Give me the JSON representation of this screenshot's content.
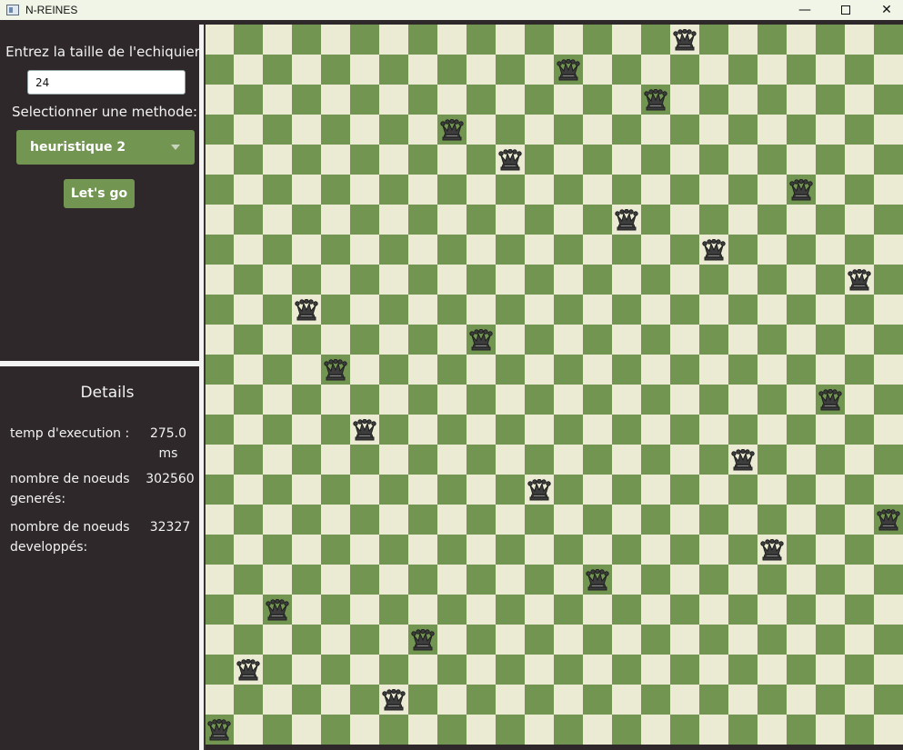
{
  "window": {
    "title": "N-REINES",
    "minimize_glyph": "—",
    "close_glyph": "✕"
  },
  "form": {
    "size_label": "Entrez la taille de l'echiquier",
    "size_value": "24",
    "method_label": "Selectionner une methode:",
    "method_selected": "heuristique 2",
    "go_label": "Let's go"
  },
  "details": {
    "title": "Details",
    "exec_label": "temp d'execution :",
    "exec_value": "275.0 ms",
    "generated_label": "nombre de noeuds generés:",
    "generated_value": "302560",
    "developed_label": "nombre de noeuds developpés:",
    "developed_value": "32327"
  },
  "board": {
    "size": 24,
    "light_color": "#ebebd3",
    "dark_color": "#739552",
    "queen_icon": "black-queen-icon",
    "queen_columns": [
      16,
      12,
      15,
      8,
      10,
      20,
      14,
      17,
      22,
      3,
      9,
      4,
      21,
      5,
      18,
      11,
      23,
      19,
      13,
      2,
      7,
      1,
      6,
      0
    ]
  },
  "colors": {
    "panel_bg": "#2e282a",
    "accent_green": "#739552",
    "text": "#f2f2f2"
  }
}
